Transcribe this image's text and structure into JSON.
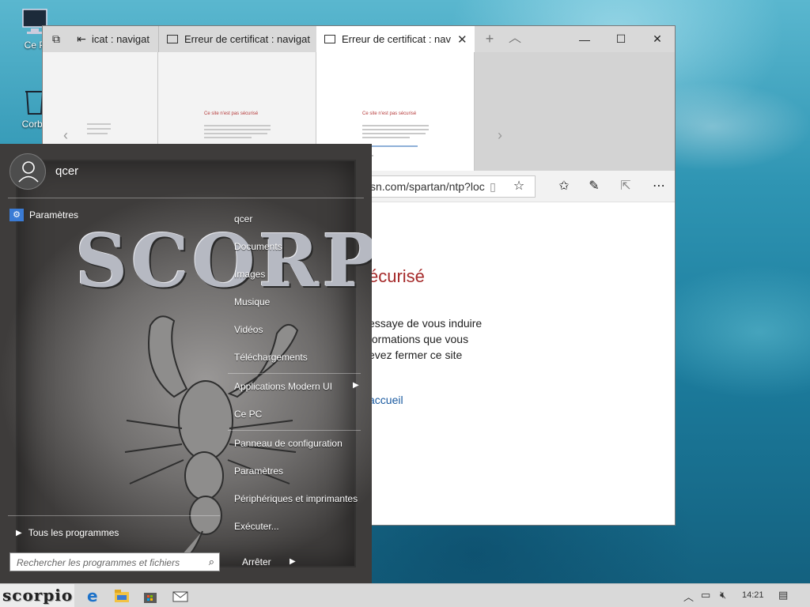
{
  "desktop": {
    "icons": [
      {
        "label": "Ce P",
        "icon": "computer-icon"
      },
      {
        "label": "Corbe",
        "icon": "recycle-bin-icon"
      }
    ]
  },
  "browser": {
    "tabs": [
      {
        "label": "icat : navigat"
      },
      {
        "label": "Erreur de certificat : navigat"
      },
      {
        "label": "Erreur de certificat : nav"
      }
    ],
    "thumb_title": "Ce site n'est pas sécurisé",
    "address": "sn.com/spartan/ntp?loc",
    "page_heading": "écurisé",
    "page_paragraph": [
      "essaye de vous induire",
      "formations que vous",
      "evez fermer ce site"
    ],
    "page_link": "accueil",
    "window_controls": {
      "minimize": "—",
      "maximize": "☐",
      "close": "✕"
    }
  },
  "start_menu": {
    "user_name": "qcer",
    "brand_text": "SCORPIO",
    "left_items": [
      {
        "label": "Paramètres",
        "icon": "settings-gear-icon"
      }
    ],
    "right_items": [
      {
        "label": "qcer"
      },
      {
        "label": "Documents"
      },
      {
        "label": "Images"
      },
      {
        "label": "Musique"
      },
      {
        "label": "Vidéos"
      },
      {
        "label": "Téléchargements"
      },
      {
        "label": "Applications Modern UI",
        "submenu": true
      },
      {
        "label": "Ce PC"
      },
      {
        "label": "Panneau de configuration"
      },
      {
        "label": "Paramètres"
      },
      {
        "label": "Périphériques et imprimantes"
      },
      {
        "label": "Exécuter..."
      }
    ],
    "all_programs": "Tous les programmes",
    "search_placeholder": "Rechercher les programmes et fichiers",
    "shutdown_label": "Arrêter"
  },
  "taskbar": {
    "start_label": "scorpio",
    "apps": [
      {
        "name": "edge-browser-icon"
      },
      {
        "name": "file-explorer-icon"
      },
      {
        "name": "store-icon"
      },
      {
        "name": "mail-icon"
      }
    ],
    "clock": "14:21",
    "tray": [
      "chevron-up-icon",
      "network-icon",
      "volume-muted-icon",
      "notification-icon"
    ]
  },
  "colors": {
    "error_red": "#a52a2a",
    "link_blue": "#1a5aa0",
    "taskbar_bg": "#d9d9d9"
  }
}
